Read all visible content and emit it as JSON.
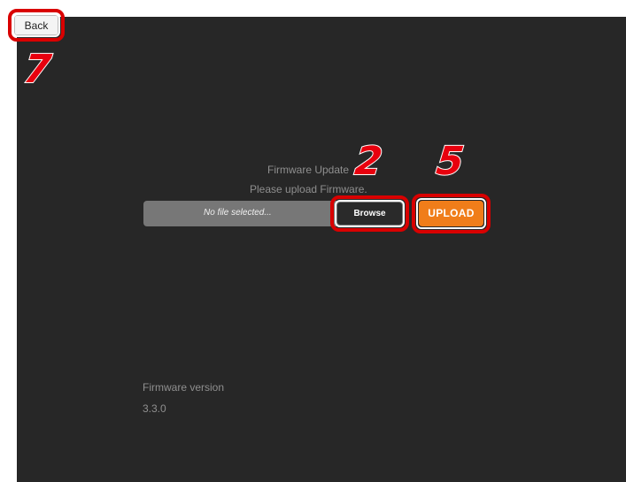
{
  "back_label": "Back",
  "update": {
    "title": "Firmware Update",
    "prompt": "Please upload Firmware.",
    "file_placeholder": "No file selected...",
    "browse_label": "Browse",
    "upload_label": "UPLOAD"
  },
  "version": {
    "label": "Firmware version",
    "value": "3.3.0"
  },
  "callouts": {
    "back": "7",
    "browse": "2",
    "upload": "5"
  },
  "colors": {
    "panel_bg": "#272727",
    "upload_orange": "#f07d1a",
    "callout_red": "#e8000e"
  }
}
